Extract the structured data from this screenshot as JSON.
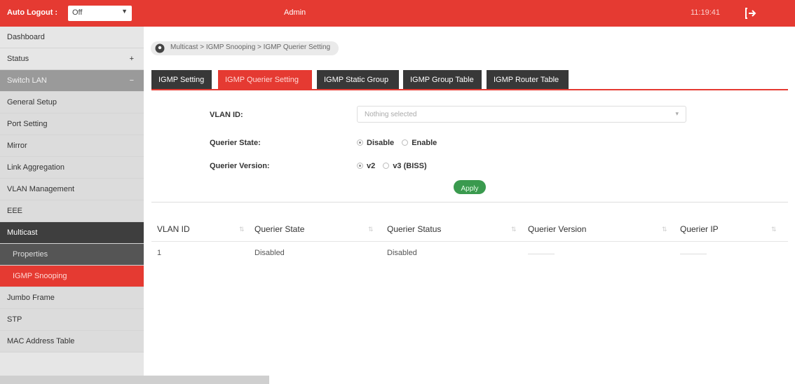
{
  "topbar": {
    "auto_logout_label": "Auto Logout :",
    "auto_logout_value": "Off",
    "user": "Admin",
    "time": "11:19:41"
  },
  "sidebar": {
    "items": [
      {
        "label": "Dashboard"
      },
      {
        "label": "Status"
      },
      {
        "label": "Switch LAN"
      },
      {
        "label": "General Setup"
      },
      {
        "label": "Port Setting"
      },
      {
        "label": "Mirror"
      },
      {
        "label": "Link Aggregation"
      },
      {
        "label": "VLAN Management"
      },
      {
        "label": "EEE"
      },
      {
        "label": "Multicast"
      },
      {
        "label": "Properties"
      },
      {
        "label": "IGMP Snooping"
      },
      {
        "label": "Jumbo Frame"
      },
      {
        "label": "STP"
      },
      {
        "label": "MAC Address Table"
      }
    ]
  },
  "breadcrumb": "Multicast > IGMP Snooping > IGMP Querier Setting",
  "tabs": [
    {
      "label": "IGMP Setting"
    },
    {
      "label": "IGMP Querier Setting"
    },
    {
      "label": "IGMP Static Group"
    },
    {
      "label": "IGMP Group Table"
    },
    {
      "label": "IGMP Router Table"
    }
  ],
  "form": {
    "vlan_id_label": "VLAN ID:",
    "vlan_id_placeholder": "Nothing selected",
    "querier_state_label": "Querier State:",
    "querier_state_options": [
      "Disable",
      "Enable"
    ],
    "querier_state_selected": "Disable",
    "querier_version_label": "Querier Version:",
    "querier_version_options": [
      "v2",
      "v3 (BISS)"
    ],
    "querier_version_selected": "v2",
    "apply_label": "Apply"
  },
  "table": {
    "columns": [
      "VLAN ID",
      "Querier State",
      "Querier Status",
      "Querier Version",
      "Querier IP"
    ],
    "rows": [
      {
        "vlan_id": "1",
        "querier_state": "Disabled",
        "querier_status": "Disabled",
        "querier_version": "",
        "querier_ip": ""
      }
    ]
  },
  "colors": {
    "accent": "#e53a32",
    "apply_green": "#3a9a4e",
    "tab_dark": "#383838"
  }
}
